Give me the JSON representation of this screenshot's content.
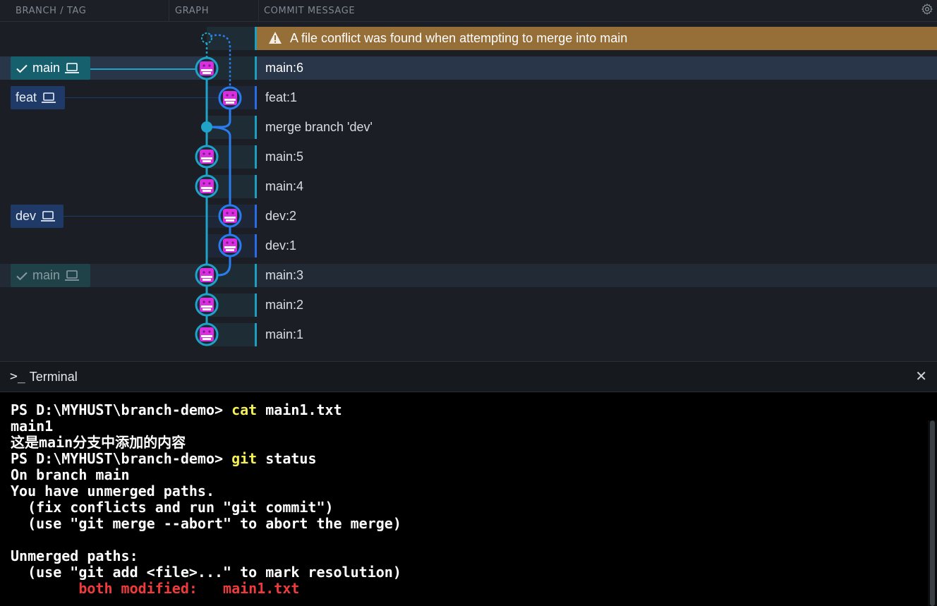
{
  "header": {
    "branch_col": "BRANCH / TAG",
    "graph_col": "GRAPH",
    "message_col": "COMMIT MESSAGE",
    "settings_icon": "gear-icon"
  },
  "warning": {
    "icon": "warning-triangle-icon",
    "text": "A file conflict was found when attempting to merge into main"
  },
  "branches": [
    {
      "label": "main",
      "checked": true,
      "icon": "laptop-icon"
    },
    {
      "label": "feat",
      "checked": false,
      "icon": "laptop-icon"
    },
    {
      "label": "dev",
      "checked": false,
      "icon": "laptop-icon"
    },
    {
      "label": "main",
      "checked": true,
      "icon": "laptop-icon"
    }
  ],
  "commits": [
    {
      "message": "main:6"
    },
    {
      "message": "feat:1"
    },
    {
      "message": "merge branch 'dev'"
    },
    {
      "message": "main:5"
    },
    {
      "message": "main:4"
    },
    {
      "message": "dev:2"
    },
    {
      "message": "dev:1"
    },
    {
      "message": "main:3"
    },
    {
      "message": "main:2"
    },
    {
      "message": "main:1"
    }
  ],
  "colors": {
    "main_lane": "#1fa3c8",
    "dev_lane": "#2a7df0",
    "avatar": "#d92fe0",
    "warning_bg": "#966e37"
  },
  "terminal": {
    "title": "Terminal",
    "title_icon": "terminal-prompt-icon",
    "close_icon": "close-icon",
    "lines": [
      {
        "a": "PS D:\\MYHUST\\branch-demo> ",
        "b": "cat",
        "c": " main1.txt"
      },
      {
        "a": "main1"
      },
      {
        "a": "这是main分支中添加的内容"
      },
      {
        "a": "PS D:\\MYHUST\\branch-demo> ",
        "b": "git",
        "c": " status"
      },
      {
        "a": "On branch main"
      },
      {
        "a": "You have unmerged paths."
      },
      {
        "a": "  (fix conflicts and run \"git commit\")"
      },
      {
        "a": "  (use \"git merge --abort\" to abort the merge)"
      },
      {
        "a": ""
      },
      {
        "a": "Unmerged paths:"
      },
      {
        "a": "  (use \"git add <file>...\" to mark resolution)"
      },
      {
        "a": "        ",
        "r": "both modified:   main1.txt"
      }
    ]
  }
}
